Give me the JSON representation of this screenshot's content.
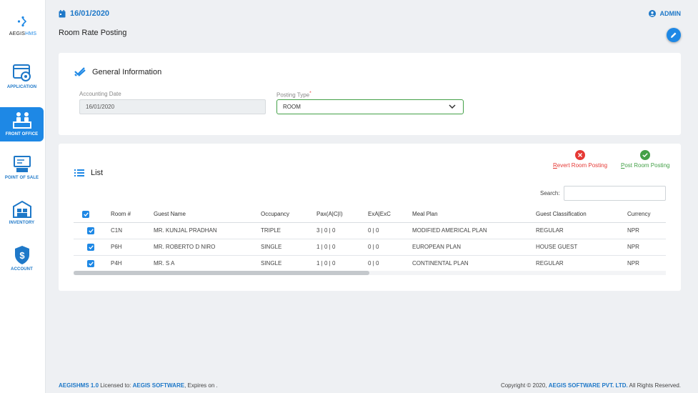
{
  "sidebar": {
    "logo": {
      "part1": "AEGIS",
      "part2": "HMS"
    },
    "items": [
      {
        "label": "APPLICATION",
        "icon": "application-gear-icon"
      },
      {
        "label": "FRONT OFFICE",
        "icon": "front-office-desk-icon",
        "active": true
      },
      {
        "label": "POINT OF SALE",
        "icon": "point-of-sale-icon"
      },
      {
        "label": "INVENTORY",
        "icon": "inventory-warehouse-icon"
      },
      {
        "label": "ACCOUNT",
        "icon": "account-money-icon"
      }
    ]
  },
  "header": {
    "date": "16/01/2020",
    "user": "ADMIN",
    "page_title": "Room Rate Posting"
  },
  "general": {
    "title": "General Information",
    "accounting_date_label": "Accounting Date",
    "accounting_date_value": "16/01/2020",
    "posting_type_label": "Posting Type",
    "posting_type_required": "*",
    "posting_type_value": "ROOM"
  },
  "list": {
    "title": "List",
    "revert": {
      "underlined": "R",
      "rest": "evert Room Posting"
    },
    "post": {
      "underlined": "P",
      "rest": "ost Room Posting"
    },
    "search_label": "Search:",
    "search_value": "",
    "columns": [
      "Room #",
      "Guest Name",
      "Occupancy",
      "Pax(A|C|I)",
      "ExA|ExC",
      "Meal Plan",
      "Guest Classification",
      "Currency"
    ],
    "rows": [
      {
        "room": "C1N",
        "guest": "MR. KUNJAL PRADHAN",
        "occupancy": "TRIPLE",
        "pax": "3 | 0 | 0",
        "ex": "0 | 0",
        "meal": "MODIFIED AMERICAL PLAN",
        "classification": "REGULAR",
        "currency": "NPR"
      },
      {
        "room": "P6H",
        "guest": "MR. ROBERTO D NIRO",
        "occupancy": "SINGLE",
        "pax": "1 | 0 | 0",
        "ex": "0 | 0",
        "meal": "EUROPEAN PLAN",
        "classification": "HOUSE GUEST",
        "currency": "NPR"
      },
      {
        "room": "P4H",
        "guest": "MR. S A",
        "occupancy": "SINGLE",
        "pax": "1 | 0 | 0",
        "ex": "0 | 0",
        "meal": "CONTINENTAL PLAN",
        "classification": "REGULAR",
        "currency": "NPR"
      }
    ]
  },
  "footer": {
    "version": "AEGISHMS 1.0",
    "licensed_to_label": " Licensed to: ",
    "licensee": "AEGIS SOFTWARE",
    "expires": ", Expires on .",
    "copyright_prefix": "Copyright © 2020, ",
    "company": "AEGIS SOFTWARE PVT. LTD.",
    "rights": " All Rights Reserved."
  },
  "colors": {
    "primary": "#1e88e5",
    "success": "#43a047",
    "danger": "#e53935"
  }
}
